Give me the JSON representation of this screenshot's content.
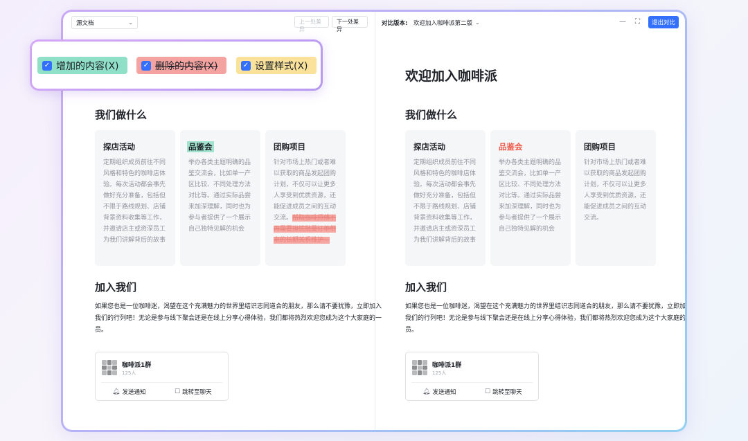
{
  "toolbar": {
    "source_select": "源文档",
    "prev_diff": "上一处差异",
    "next_diff": "下一处差异",
    "compare_label": "对比版本:",
    "compare_version": "欢迎加入咖啡派第二版",
    "exit_button": "退出对比"
  },
  "legend": {
    "added": "增加的内容(X)",
    "deleted": "删除的内容(X)",
    "styled": "设置样式(X)",
    "colors": {
      "added": "#8fe0c6",
      "deleted": "#f4a3a0",
      "styled": "#fbe29a"
    }
  },
  "left_doc": {
    "section_what": "我们做什么",
    "cards": [
      {
        "title": "探店活动",
        "body": "定期组织成员前往不同风格和特色的咖啡店体验。每次活动都会事先做好充分准备，包括但不限于路线规划、店铺背景资料收集等工作，并邀请店主或资深员工为我们讲解背后的故事"
      },
      {
        "title": "品鉴会",
        "body": "举办各类主题明确的品鉴交流会，比如单一产区比较、不同处理方法对比等。通过实际品尝来加深理解，同时也为参与者提供了一个展示自己独特见解的机会"
      },
      {
        "title": "团购项目",
        "body": "针对市场上热门或者难以获取的商品发起团购计划，不仅可以让更多人享受到优质资源，还能促进成员之间的互动交流。",
        "deleted": "帮助咖啡师傅不再需要担忧批量订单带来的长期关系维护—"
      }
    ],
    "section_join": "加入我们",
    "join_text": "如果您也是一位咖啡迷，渴望在这个充满魅力的世界里结识志同道合的朋友，那么请不要犹豫，立即加入我们的行列吧！无论是参与线下聚会还是在线上分享心得体验，我们都将热烈欢迎您成为这个大家庭的一员。",
    "group": {
      "name": "咖啡派1群",
      "count": "125人",
      "notify": "发送通知",
      "jump": "跳转至聊天"
    }
  },
  "right_doc": {
    "title": "欢迎加入咖啡派",
    "section_what": "我们做什么",
    "cards": [
      {
        "title": "探店活动",
        "body": "定期组织成员前往不同风格和特色的咖啡店体验。每次活动都会事先做好充分准备，包括但不限于路线规划、店铺背景资料收集等工作，并邀请店主或资深员工为我们讲解背后的故事"
      },
      {
        "title": "品鉴会",
        "body": "举办各类主题明确的品鉴交流会，比如单一产区比较、不同处理方法对比等。通过实际品尝来加深理解，同时也为参与者提供了一个展示自己独特见解的机会"
      },
      {
        "title": "团购项目",
        "body": "针对市场上热门或者难以获取的商品发起团购计划，不仅可以让更多人享受到优质资源，还能促进成员之间的互动交流。"
      }
    ],
    "section_join": "加入我们",
    "join_text": "如果您也是一位咖啡迷，渴望在这个充满魅力的世界里结识志同道合的朋友，那么请不要犹豫，立即加入我们的行列吧！无论是参与线下聚会还是在线上分享心得体验，我们都将热烈欢迎您成为这个大家庭的一员。",
    "group": {
      "name": "咖啡派1群",
      "count": "125人",
      "notify": "发送通知",
      "jump": "跳转至聊天"
    }
  }
}
